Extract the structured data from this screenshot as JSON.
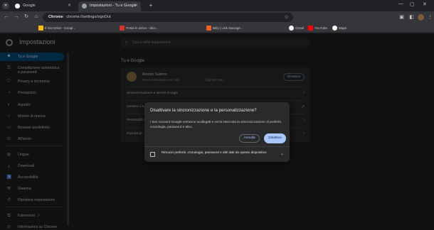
{
  "browser": {
    "tabs": [
      {
        "label": "Google"
      },
      {
        "label": "Impostazioni - Tu e Google"
      }
    ],
    "omnibox": {
      "chip": "Chrome",
      "url": "chrome://settings/signOut"
    },
    "bookmarks": [
      {
        "label": "Il mio Drive - Googl..."
      },
      {
        "label": "Posta in arrivo - alco..."
      },
      {
        "label": "Bitly | Link Manage..."
      },
      {
        "label": "Gmail"
      },
      {
        "label": "YouTube"
      },
      {
        "label": "Maps"
      }
    ],
    "colors": {
      "accent": "#a8c7fa",
      "active_nav": "#004a77",
      "background": "#1f1f1f"
    }
  },
  "settings": {
    "title": "Impostazioni",
    "search_placeholder": "Cerca nelle impostazioni",
    "nav": [
      {
        "label": "Tu e Google",
        "icon": "person-icon"
      },
      {
        "label": "Compilazione automatica",
        "label2": "e password",
        "icon": "key-icon"
      },
      {
        "label": "Privacy e sicurezza",
        "icon": "shield-icon"
      },
      {
        "label": "Prestazioni",
        "icon": "gauge-icon"
      },
      {
        "label": "Aspetto",
        "icon": "palette-icon"
      },
      {
        "label": "Motore di ricerca",
        "icon": "search-icon"
      },
      {
        "label": "Browser predefinito",
        "icon": "browser-icon"
      },
      {
        "label": "All'avvio",
        "icon": "power-icon"
      },
      {
        "label": "Lingue",
        "icon": "globe-icon"
      },
      {
        "label": "Download",
        "icon": "download-icon"
      },
      {
        "label": "Accessibilità",
        "icon": "accessibility-icon"
      },
      {
        "label": "Sistema",
        "icon": "wrench-icon"
      },
      {
        "label": "Ripristina impostazioni",
        "icon": "reset-icon"
      },
      {
        "label": "Estensioni",
        "icon": "puzzle-icon"
      },
      {
        "label": "Informazioni su Chrome",
        "icon": "chrome-icon"
      }
    ],
    "section_title": "Tu e Google",
    "account": {
      "name": "Alessio Salerno",
      "status": "Sincronizzazione con: ale",
      "email_suffix": "@gmail.com",
      "button": "Disattiva"
    },
    "rows": [
      {
        "label": "Sincronizzazione e servizi Google"
      },
      {
        "label": "Gestisci il tuo..."
      },
      {
        "label": "Personalizza..."
      },
      {
        "label": "Importa pr..."
      }
    ]
  },
  "dialog": {
    "title": "Disattivare la sincronizzazione e la personalizzazione?",
    "body": "I tuoi Account Google verranno scollegati e verrà interrotta la sincronizzazione di preferiti, cronologia, password e altro.",
    "cancel_label": "Annulla",
    "confirm_label": "Disattiva",
    "checkbox_label": "Rimuovi preferiti, cronologia, password e altri dati da questo dispositivo",
    "checkbox_checked": false
  }
}
